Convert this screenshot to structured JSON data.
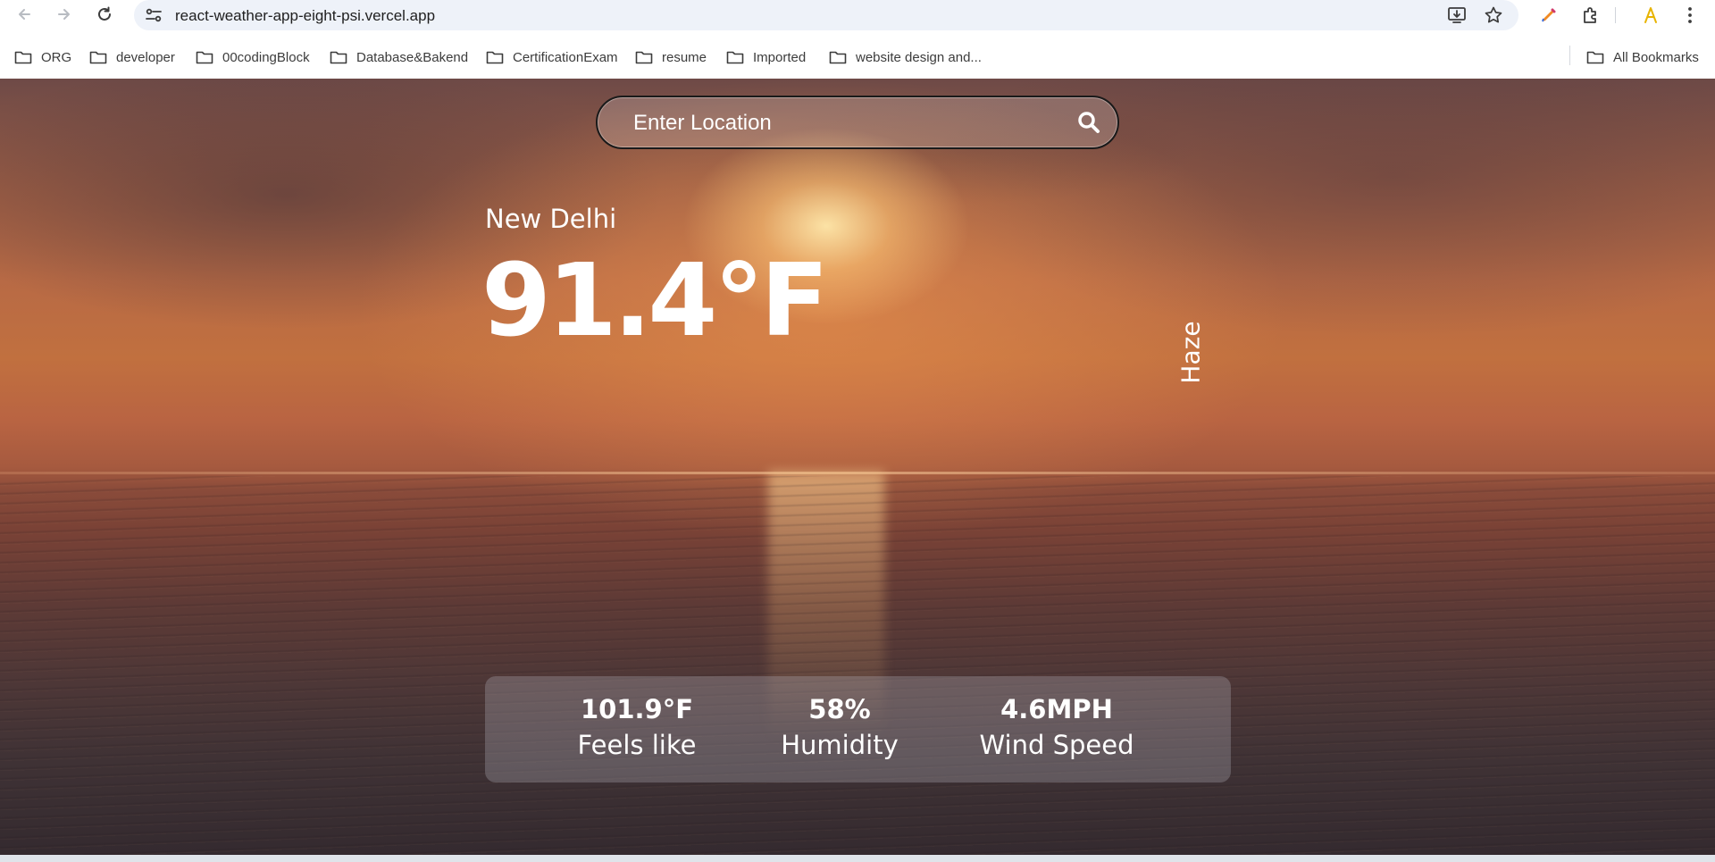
{
  "browser": {
    "url": "react-weather-app-eight-psi.vercel.app",
    "bookmarks": [
      "ORG",
      "developer",
      "00codingBlock",
      "Database&Bakend",
      "CertificationExam",
      "resume",
      "Imported",
      "website design and..."
    ],
    "all_bookmarks_label": "All Bookmarks"
  },
  "search": {
    "placeholder": "Enter Location",
    "value": ""
  },
  "weather": {
    "city": "New Delhi",
    "temperature": "91.4°F",
    "description": "Haze",
    "feels_like_value": "101.9°F",
    "feels_like_label": "Feels like",
    "humidity_value": "58%",
    "humidity_label": "Humidity",
    "wind_value": "4.6MPH",
    "wind_label": "Wind Speed"
  },
  "icons": {
    "back": "back-arrow-icon",
    "forward": "forward-arrow-icon",
    "reload": "reload-icon",
    "site_info": "site-info-icon",
    "install": "install-app-icon",
    "bookmark_star": "bookmark-star-icon",
    "extension_pen": "pen-extension-icon",
    "extensions": "puzzle-extensions-icon",
    "profile": "profile-icon",
    "menu": "kebab-menu-icon",
    "folder": "folder-icon",
    "search": "search-icon"
  },
  "colors": {
    "text_on_image": "#ffffff",
    "omnibox_bg": "#eef2f9",
    "stats_panel_bg": "rgba(190,190,200,0.28)"
  }
}
